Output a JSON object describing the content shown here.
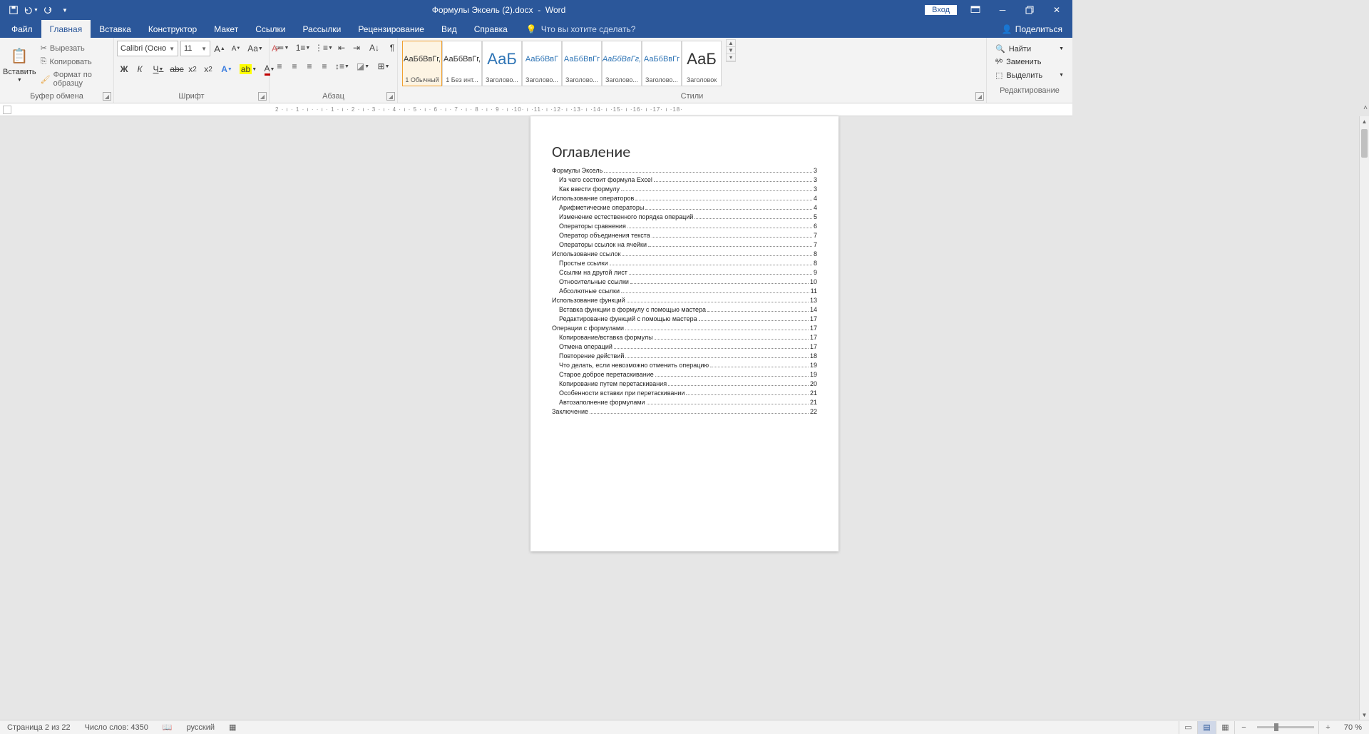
{
  "app": {
    "title_doc": "Формулы Эксель (2).docx",
    "title_app": "Word",
    "login": "Вход"
  },
  "tabs": {
    "file": "Файл",
    "home": "Главная",
    "insert": "Вставка",
    "design": "Конструктор",
    "layout": "Макет",
    "references": "Ссылки",
    "mailings": "Рассылки",
    "review": "Рецензирование",
    "view": "Вид",
    "help": "Справка",
    "tell_me": "Что вы хотите сделать?",
    "share": "Поделиться"
  },
  "clipboard": {
    "paste": "Вставить",
    "cut": "Вырезать",
    "copy": "Копировать",
    "format_painter": "Формат по образцу",
    "group": "Буфер обмена"
  },
  "font": {
    "name": "Calibri (Осно",
    "size": "11",
    "group": "Шрифт"
  },
  "paragraph": {
    "group": "Абзац"
  },
  "styles": {
    "group": "Стили",
    "items": [
      {
        "preview": "АаБбВвГг,",
        "name": "1 Обычный",
        "cls": ""
      },
      {
        "preview": "АаБбВвГг,",
        "name": "1 Без инт...",
        "cls": ""
      },
      {
        "preview": "АаБ",
        "name": "Заголово...",
        "cls": "blue big"
      },
      {
        "preview": "АаБбВвГ",
        "name": "Заголово...",
        "cls": "blue"
      },
      {
        "preview": "АаБбВвГг",
        "name": "Заголово...",
        "cls": "blue"
      },
      {
        "preview": "АаБбВвГг,",
        "name": "Заголово...",
        "cls": "blue it"
      },
      {
        "preview": "АаБбВвГг",
        "name": "Заголово...",
        "cls": "blue"
      },
      {
        "preview": "АаБ",
        "name": "Заголовок",
        "cls": "big"
      }
    ]
  },
  "editing": {
    "find": "Найти",
    "replace": "Заменить",
    "select": "Выделить",
    "group": "Редактирование"
  },
  "ruler": "2 · ı · 1 · ı ·    · ı · 1 · ı · 2 · ı · 3 · ı · 4 · ı · 5 · ı · 6 · ı · 7 · ı · 8 · ı · 9 · ı ·10· ı ·11· ı ·12· ı ·13· ı ·14· ı ·15· ı ·16· ı ·17· ı ·18·",
  "document": {
    "toc_title": "Оглавление",
    "toc": [
      {
        "level": 1,
        "text": "Формулы Эксель",
        "page": "3"
      },
      {
        "level": 2,
        "text": "Из чего состоит формула Excel",
        "page": "3"
      },
      {
        "level": 2,
        "text": "Как ввести формулу",
        "page": "3"
      },
      {
        "level": 1,
        "text": "Использование операторов",
        "page": "4"
      },
      {
        "level": 2,
        "text": "Арифметические операторы",
        "page": "4"
      },
      {
        "level": 2,
        "text": "Изменение естественного порядка операций",
        "page": "5"
      },
      {
        "level": 2,
        "text": "Операторы сравнения",
        "page": "6"
      },
      {
        "level": 2,
        "text": "Оператор объединения текста",
        "page": "7"
      },
      {
        "level": 2,
        "text": "Операторы ссылок на ячейки",
        "page": "7"
      },
      {
        "level": 1,
        "text": "Использование ссылок",
        "page": "8"
      },
      {
        "level": 2,
        "text": "Простые ссылки",
        "page": "8"
      },
      {
        "level": 2,
        "text": "Ссылки на другой лист",
        "page": "9"
      },
      {
        "level": 2,
        "text": "Относительные ссылки",
        "page": "10"
      },
      {
        "level": 2,
        "text": "Абсолютные ссылки",
        "page": "11"
      },
      {
        "level": 1,
        "text": "Использование функций",
        "page": "13"
      },
      {
        "level": 2,
        "text": "Вставка функции в формулу с помощью мастера",
        "page": "14"
      },
      {
        "level": 2,
        "text": "Редактирование функций с помощью мастера",
        "page": "17"
      },
      {
        "level": 1,
        "text": "Операции с формулами",
        "page": "17"
      },
      {
        "level": 2,
        "text": "Копирование/вставка формулы",
        "page": "17"
      },
      {
        "level": 2,
        "text": "Отмена операций",
        "page": "17"
      },
      {
        "level": 2,
        "text": "Повторение действий",
        "page": "18"
      },
      {
        "level": 2,
        "text": "Что делать, если невозможно отменить операцию",
        "page": "19"
      },
      {
        "level": 2,
        "text": "Старое доброе перетаскивание",
        "page": "19"
      },
      {
        "level": 2,
        "text": "Копирование путем перетаскивания",
        "page": "20"
      },
      {
        "level": 2,
        "text": "Особенности вставки при перетаскивании",
        "page": "21"
      },
      {
        "level": 2,
        "text": "Автозаполнение формулами",
        "page": "21"
      },
      {
        "level": 1,
        "text": "Заключение",
        "page": "22"
      }
    ]
  },
  "status": {
    "page": "Страница 2 из 22",
    "words": "Число слов: 4350",
    "lang": "русский",
    "zoom": "70 %"
  }
}
